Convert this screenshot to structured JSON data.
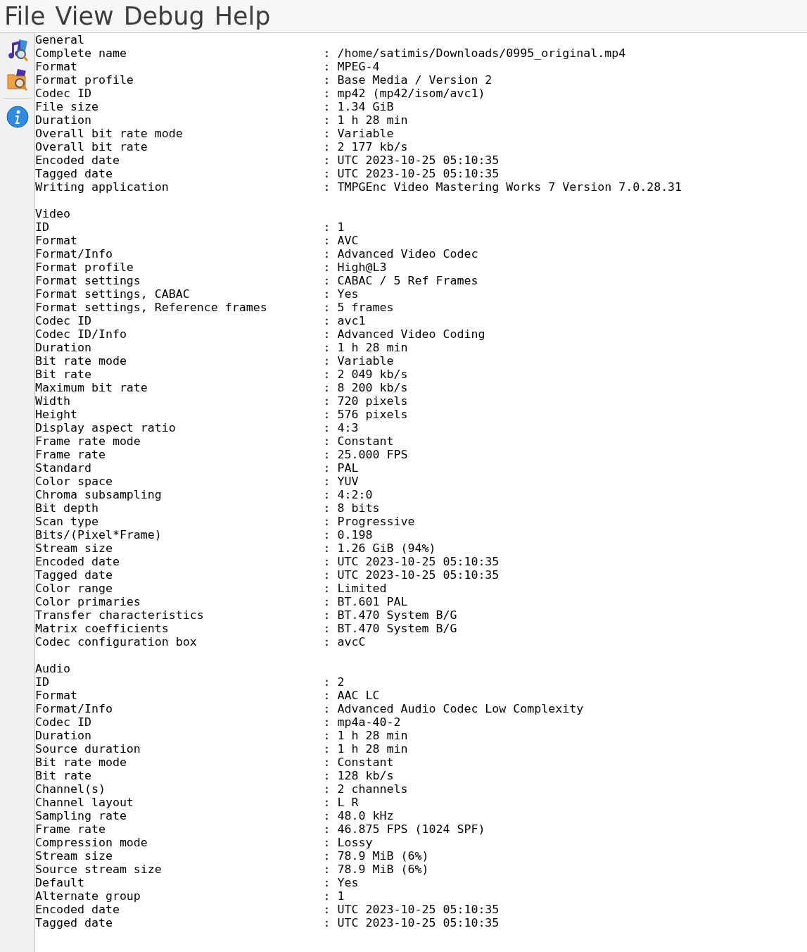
{
  "menu": [
    "File",
    "View",
    "Debug",
    "Help"
  ],
  "sections": [
    {
      "title": "General",
      "fields": [
        {
          "label": "Complete name",
          "value": ": /home/satimis/Downloads/0995_original.mp4"
        },
        {
          "label": "Format",
          "value": ": MPEG-4"
        },
        {
          "label": "Format profile",
          "value": ": Base Media / Version 2"
        },
        {
          "label": "Codec ID",
          "value": ": mp42 (mp42/isom/avc1)"
        },
        {
          "label": "File size",
          "value": ": 1.34 GiB"
        },
        {
          "label": "Duration",
          "value": ": 1 h 28 min"
        },
        {
          "label": "Overall bit rate mode",
          "value": ": Variable"
        },
        {
          "label": "Overall bit rate",
          "value": ": 2 177 kb/s"
        },
        {
          "label": "Encoded date",
          "value": ": UTC 2023-10-25 05:10:35"
        },
        {
          "label": "Tagged date",
          "value": ": UTC 2023-10-25 05:10:35"
        },
        {
          "label": "Writing application",
          "value": ": TMPGEnc Video Mastering Works 7 Version 7.0.28.31"
        }
      ]
    },
    {
      "title": "Video",
      "fields": [
        {
          "label": "ID",
          "value": ": 1"
        },
        {
          "label": "Format",
          "value": ": AVC"
        },
        {
          "label": "Format/Info",
          "value": ": Advanced Video Codec"
        },
        {
          "label": "Format profile",
          "value": ": High@L3"
        },
        {
          "label": "Format settings",
          "value": ": CABAC / 5 Ref Frames"
        },
        {
          "label": "Format settings, CABAC",
          "value": ": Yes"
        },
        {
          "label": "Format settings, Reference frames",
          "value": ": 5 frames"
        },
        {
          "label": "Codec ID",
          "value": ": avc1"
        },
        {
          "label": "Codec ID/Info",
          "value": ": Advanced Video Coding"
        },
        {
          "label": "Duration",
          "value": ": 1 h 28 min"
        },
        {
          "label": "Bit rate mode",
          "value": ": Variable"
        },
        {
          "label": "Bit rate",
          "value": ": 2 049 kb/s"
        },
        {
          "label": "Maximum bit rate",
          "value": ": 8 200 kb/s"
        },
        {
          "label": "Width",
          "value": ": 720 pixels"
        },
        {
          "label": "Height",
          "value": ": 576 pixels"
        },
        {
          "label": "Display aspect ratio",
          "value": ": 4:3"
        },
        {
          "label": "Frame rate mode",
          "value": ": Constant"
        },
        {
          "label": "Frame rate",
          "value": ": 25.000 FPS"
        },
        {
          "label": "Standard",
          "value": ": PAL"
        },
        {
          "label": "Color space",
          "value": ": YUV"
        },
        {
          "label": "Chroma subsampling",
          "value": ": 4:2:0"
        },
        {
          "label": "Bit depth",
          "value": ": 8 bits"
        },
        {
          "label": "Scan type",
          "value": ": Progressive"
        },
        {
          "label": "Bits/(Pixel*Frame)",
          "value": ": 0.198"
        },
        {
          "label": "Stream size",
          "value": ": 1.26 GiB (94%)"
        },
        {
          "label": "Encoded date",
          "value": ": UTC 2023-10-25 05:10:35"
        },
        {
          "label": "Tagged date",
          "value": ": UTC 2023-10-25 05:10:35"
        },
        {
          "label": "Color range",
          "value": ": Limited"
        },
        {
          "label": "Color primaries",
          "value": ": BT.601 PAL"
        },
        {
          "label": "Transfer characteristics",
          "value": ": BT.470 System B/G"
        },
        {
          "label": "Matrix coefficients",
          "value": ": BT.470 System B/G"
        },
        {
          "label": "Codec configuration box",
          "value": ": avcC"
        }
      ]
    },
    {
      "title": "Audio",
      "fields": [
        {
          "label": "ID",
          "value": ": 2"
        },
        {
          "label": "Format",
          "value": ": AAC LC"
        },
        {
          "label": "Format/Info",
          "value": ": Advanced Audio Codec Low Complexity"
        },
        {
          "label": "Codec ID",
          "value": ": mp4a-40-2"
        },
        {
          "label": "Duration",
          "value": ": 1 h 28 min"
        },
        {
          "label": "Source duration",
          "value": ": 1 h 28 min"
        },
        {
          "label": "Bit rate mode",
          "value": ": Constant"
        },
        {
          "label": "Bit rate",
          "value": ": 128 kb/s"
        },
        {
          "label": "Channel(s)",
          "value": ": 2 channels"
        },
        {
          "label": "Channel layout",
          "value": ": L R"
        },
        {
          "label": "Sampling rate",
          "value": ": 48.0 kHz"
        },
        {
          "label": "Frame rate",
          "value": ": 46.875 FPS (1024 SPF)"
        },
        {
          "label": "Compression mode",
          "value": ": Lossy"
        },
        {
          "label": "Stream size",
          "value": ": 78.9 MiB (6%)"
        },
        {
          "label": "Source stream size",
          "value": ": 78.9 MiB (6%)"
        },
        {
          "label": "Default",
          "value": ": Yes"
        },
        {
          "label": "Alternate group",
          "value": ": 1"
        },
        {
          "label": "Encoded date",
          "value": ": UTC 2023-10-25 05:10:35"
        },
        {
          "label": "Tagged date",
          "value": ": UTC 2023-10-25 05:10:35"
        }
      ]
    }
  ]
}
